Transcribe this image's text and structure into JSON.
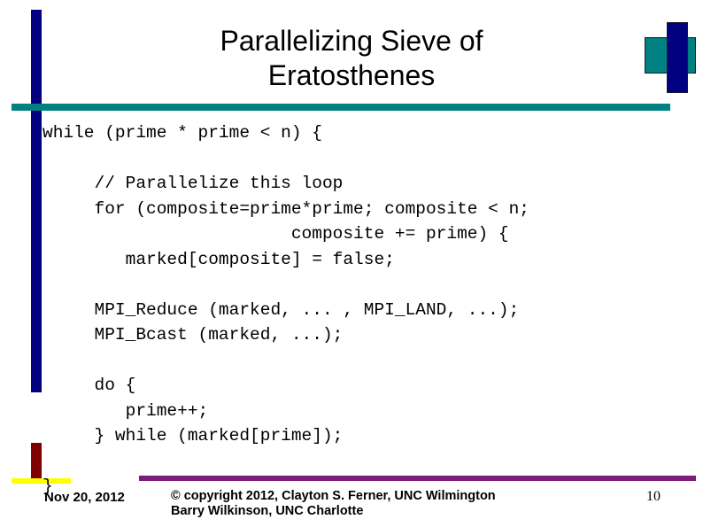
{
  "slide": {
    "title_lines": [
      "Parallelizing Sieve of",
      "Eratosthenes"
    ],
    "code_lines": [
      "while (prime * prime < n) {",
      "",
      "     // Parallelize this loop",
      "     for (composite=prime*prime; composite < n;",
      "                        composite += prime) {",
      "        marked[composite] = false;",
      "",
      "     MPI_Reduce (marked, ... , MPI_LAND, ...);",
      "     MPI_Bcast (marked, ...);",
      "",
      "     do {",
      "        prime++;",
      "     } while (marked[prime]);",
      "",
      "}"
    ],
    "footer": {
      "date": "Nov 20, 2012",
      "copyright_line1": "© copyright 2012, Clayton S. Ferner, UNC Wilmington",
      "copyright_line2": "Barry Wilkinson, UNC Charlotte",
      "page_number": "10"
    },
    "colors": {
      "navy": "#000080",
      "teal": "#008080",
      "maroon": "#800000",
      "yellow": "#ffff00",
      "purple": "#7b1e7b",
      "text": "#000000",
      "background": "#ffffff"
    }
  }
}
